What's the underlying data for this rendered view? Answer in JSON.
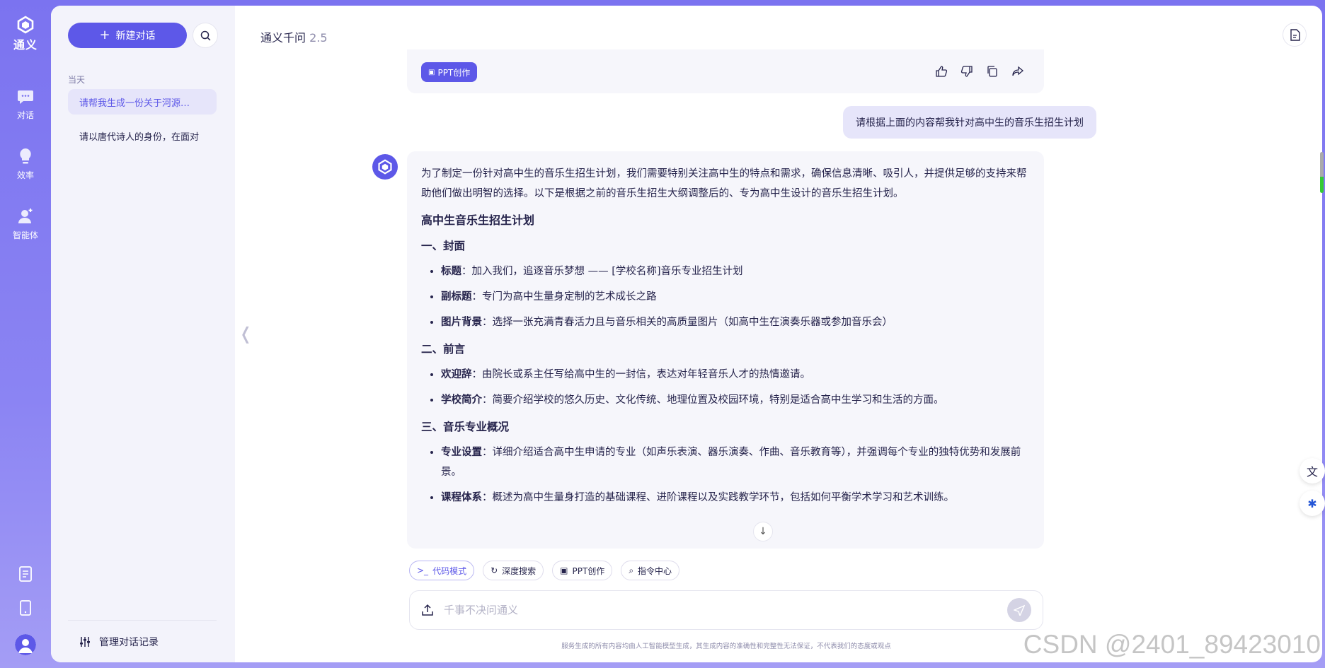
{
  "rail": {
    "logo_text": "通义",
    "items": [
      {
        "label": "对话",
        "icon": "chat-bubble-icon"
      },
      {
        "label": "效率",
        "icon": "lightbulb-icon"
      },
      {
        "label": "智能体",
        "icon": "agent-icon"
      }
    ],
    "bottom_icons": [
      "document-icon",
      "mobile-icon",
      "user-avatar-icon"
    ]
  },
  "sidebar": {
    "new_chat_label": "新建对话",
    "section_today": "当天",
    "conversations": [
      {
        "title": "请帮我生成一份关于河源…"
      },
      {
        "title": "请以唐代诗人的身份，在面对"
      }
    ],
    "manage_label": "管理对话记录"
  },
  "header": {
    "title": "通义千问",
    "version": "2.5"
  },
  "previous_card": {
    "tag_label": "PPT创作",
    "actions": [
      "thumbs-up-icon",
      "thumbs-down-icon",
      "copy-icon",
      "share-icon"
    ]
  },
  "user_message": "请根据上面的内容帮我针对高中生的音乐生招生计划",
  "answer": {
    "intro": "为了制定一份针对高中生的音乐生招生计划，我们需要特别关注高中生的特点和需求，确保信息清晰、吸引人，并提供足够的支持来帮助他们做出明智的选择。以下是根据之前的音乐生招生大纲调整后的、专为高中生设计的音乐生招生计划。",
    "title": "高中生音乐生招生计划",
    "sections": [
      {
        "heading": "一、封面",
        "items": [
          {
            "key": "标题",
            "text": "：加入我们，追逐音乐梦想 —— [学校名称]音乐专业招生计划"
          },
          {
            "key": "副标题",
            "text": "：专门为高中生量身定制的艺术成长之路"
          },
          {
            "key": "图片背景",
            "text": "：选择一张充满青春活力且与音乐相关的高质量图片（如高中生在演奏乐器或参加音乐会）"
          }
        ]
      },
      {
        "heading": "二、前言",
        "items": [
          {
            "key": "欢迎辞",
            "text": "：由院长或系主任写给高中生的一封信，表达对年轻音乐人才的热情邀请。"
          },
          {
            "key": "学校简介",
            "text": "：简要介绍学校的悠久历史、文化传统、地理位置及校园环境，特别是适合高中生学习和生活的方面。"
          }
        ]
      },
      {
        "heading": "三、音乐专业概况",
        "items": [
          {
            "key": "专业设置",
            "text": "：详细介绍适合高中生申请的专业（如声乐表演、器乐演奏、作曲、音乐教育等），并强调每个专业的独特优势和发展前景。"
          },
          {
            "key": "课程体系",
            "text": "：概述为高中生量身打造的基础课程、进阶课程以及实践教学环节，包括如何平衡学术学习和艺术训练。"
          }
        ]
      }
    ]
  },
  "tools": [
    {
      "label": "代码模式",
      "icon": "terminal-icon",
      "active": true
    },
    {
      "label": "深度搜索",
      "icon": "refresh-search-icon",
      "active": false
    },
    {
      "label": "PPT创作",
      "icon": "presentation-icon",
      "active": false
    },
    {
      "label": "指令中心",
      "icon": "command-icon",
      "active": false
    }
  ],
  "input": {
    "placeholder": "千事不决问通义"
  },
  "disclaimer": "服务生成的所有内容均由人工智能模型生成，其生成内容的准确性和完整性无法保证，不代表我们的态度或观点",
  "watermark": "CSDN @2401_89423010",
  "colors": {
    "accent": "#5d58e8",
    "rail_bg": "#7b73f0",
    "active_item_bg": "#e6e5fa"
  }
}
